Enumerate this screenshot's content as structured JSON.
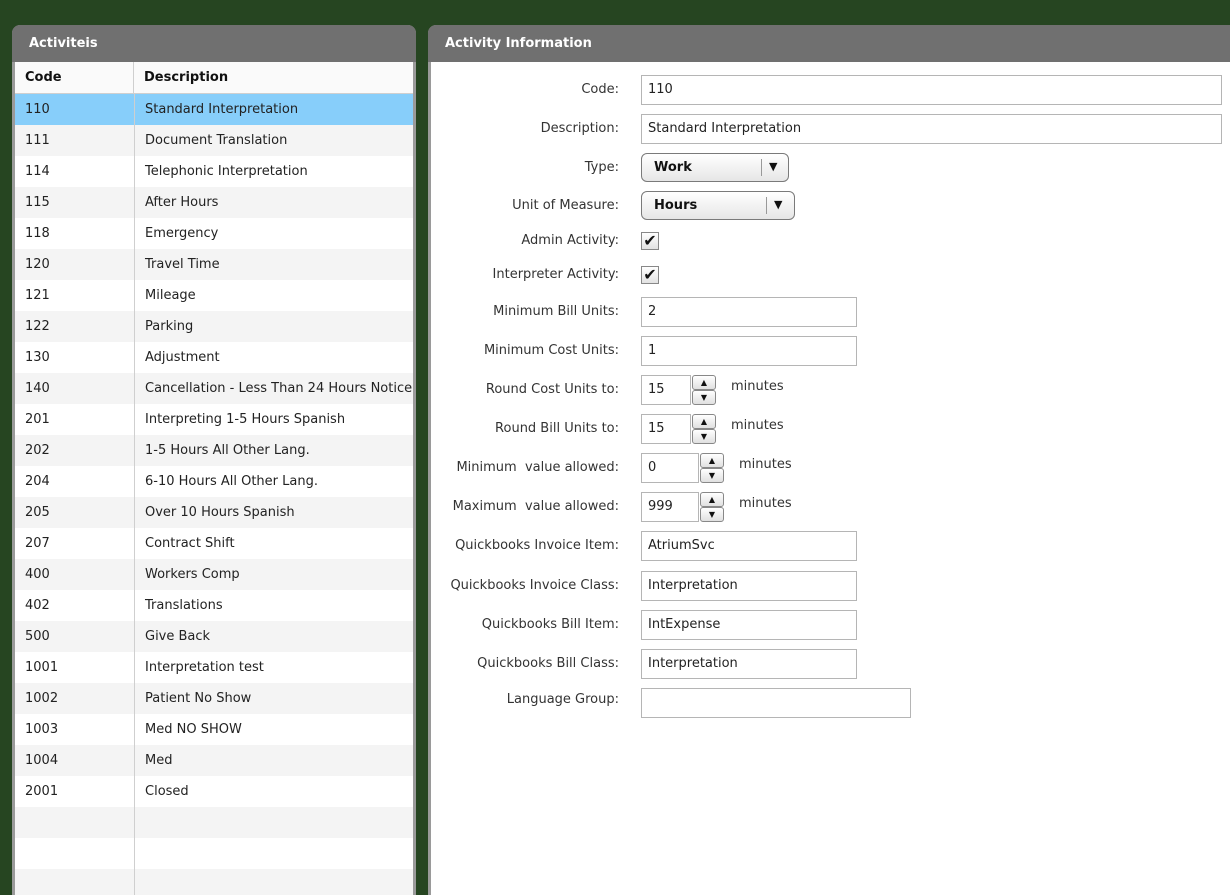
{
  "left_panel": {
    "title": "Activiteis",
    "columns": [
      "Code",
      "Description"
    ],
    "rows": [
      {
        "code": "110",
        "desc": "Standard Interpretation"
      },
      {
        "code": "111",
        "desc": "Document Translation"
      },
      {
        "code": "114",
        "desc": "Telephonic Interpretation"
      },
      {
        "code": "115",
        "desc": "After Hours"
      },
      {
        "code": "118",
        "desc": "Emergency"
      },
      {
        "code": "120",
        "desc": "Travel Time"
      },
      {
        "code": "121",
        "desc": "Mileage"
      },
      {
        "code": "122",
        "desc": "Parking"
      },
      {
        "code": "130",
        "desc": "Adjustment"
      },
      {
        "code": "140",
        "desc": "Cancellation - Less Than 24 Hours Notice"
      },
      {
        "code": "201",
        "desc": "Interpreting 1-5 Hours Spanish"
      },
      {
        "code": "202",
        "desc": "1-5 Hours All Other Lang."
      },
      {
        "code": "204",
        "desc": "6-10 Hours All Other Lang."
      },
      {
        "code": "205",
        "desc": "Over 10 Hours Spanish"
      },
      {
        "code": "207",
        "desc": "Contract Shift"
      },
      {
        "code": "400",
        "desc": "Workers Comp"
      },
      {
        "code": "402",
        "desc": "Translations"
      },
      {
        "code": "500",
        "desc": "Give Back"
      },
      {
        "code": "1001",
        "desc": "Interpretation test"
      },
      {
        "code": "1002",
        "desc": "Patient No Show"
      },
      {
        "code": "1003",
        "desc": "Med NO SHOW"
      },
      {
        "code": "1004",
        "desc": "Med"
      },
      {
        "code": "2001",
        "desc": "Closed"
      },
      {
        "code": "",
        "desc": ""
      },
      {
        "code": "",
        "desc": ""
      },
      {
        "code": "",
        "desc": ""
      }
    ]
  },
  "right_panel": {
    "title": "Activity Information",
    "labels": {
      "code": "Code:",
      "description": "Description:",
      "type": "Type:",
      "unit": "Unit of Measure:",
      "admin": "Admin Activity:",
      "interpreter": "Interpreter Activity:",
      "min_bill": "Minimum Bill Units:",
      "min_cost": "Minimum Cost Units:",
      "round_cost": "Round Cost Units to:",
      "round_bill": "Round Bill Units to:",
      "min_value": "Minimum  value allowed:",
      "max_value": "Maximum  value allowed:",
      "qb_inv_item": "Quickbooks Invoice Item:",
      "qb_inv_class": "Quickbooks Invoice Class:",
      "qb_bill_item": "Quickbooks Bill Item:",
      "qb_bill_class": "Quickbooks Bill Class:",
      "lang_group": "Language Group:"
    },
    "values": {
      "code": "110",
      "description": "Standard Interpretation",
      "type": "Work",
      "unit": "Hours",
      "admin_checked": true,
      "interpreter_checked": true,
      "min_bill": "2",
      "min_cost": "1",
      "round_cost": "15",
      "round_bill": "15",
      "min_value": "0",
      "max_value": "999",
      "qb_inv_item": "AtriumSvc",
      "qb_inv_class": "Interpretation",
      "qb_bill_item": "IntExpense",
      "qb_bill_class": "Interpretation",
      "lang_group": ""
    },
    "units_label": "minutes",
    "check_mark": "✔",
    "arrow_down": "▼",
    "spin_up": "▲",
    "spin_down": "▼"
  }
}
